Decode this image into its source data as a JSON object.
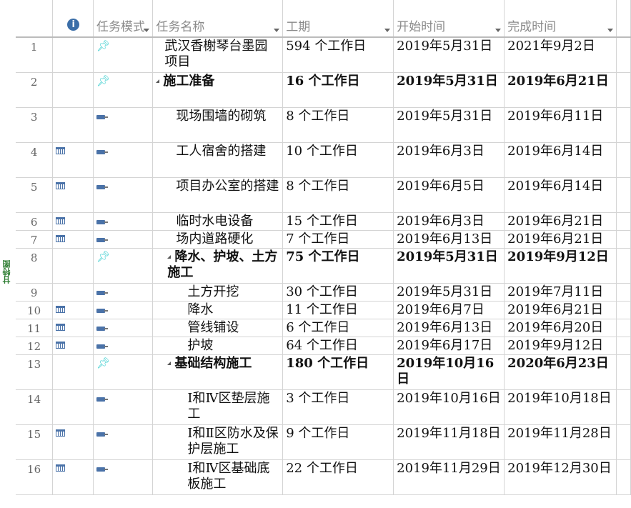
{
  "side_label": "甘特图",
  "columns": {
    "mode": "任务模式",
    "name": "任务名称",
    "duration": "工期",
    "start": "开始时间",
    "finish": "完成时间"
  },
  "rows": [
    {
      "id": "1",
      "info": false,
      "mode": "manual",
      "level": 0,
      "bold": false,
      "name": "武汉香榭琴台墨园项目",
      "duration": "594 个工作日",
      "start": "2019年5月31日",
      "finish": "2021年9月2日"
    },
    {
      "id": "2",
      "info": false,
      "mode": "manual",
      "level": 0,
      "bold": true,
      "summary": true,
      "name": "施工准备",
      "duration": "16 个工作日",
      "start": "2019年5月31日",
      "finish": "2019年6月21日"
    },
    {
      "id": "3",
      "info": false,
      "mode": "auto",
      "level": 1,
      "bold": false,
      "name": "现场围墙的砌筑",
      "duration": "8 个工作日",
      "start": "2019年5月31日",
      "finish": "2019年6月11日"
    },
    {
      "id": "4",
      "info": true,
      "mode": "auto",
      "level": 1,
      "bold": false,
      "name": "工人宿舍的搭建",
      "duration": "10 个工作日",
      "start": "2019年6月3日",
      "finish": "2019年6月14日"
    },
    {
      "id": "5",
      "info": true,
      "mode": "auto",
      "level": 1,
      "bold": false,
      "name": "项目办公室的搭建",
      "duration": "8 个工作日",
      "start": "2019年6月5日",
      "finish": "2019年6月14日"
    },
    {
      "id": "6",
      "info": true,
      "mode": "auto",
      "level": 1,
      "bold": false,
      "name": "临时水电设备",
      "duration": "15 个工作日",
      "start": "2019年6月3日",
      "finish": "2019年6月21日"
    },
    {
      "id": "7",
      "info": true,
      "mode": "auto",
      "level": 1,
      "bold": false,
      "name": "场内道路硬化",
      "duration": "7 个工作日",
      "start": "2019年6月13日",
      "finish": "2019年6月21日"
    },
    {
      "id": "8",
      "info": false,
      "mode": "manual",
      "level": 1,
      "bold": true,
      "summary": true,
      "name": "降水、护坡、土方施工",
      "duration": "75 个工作日",
      "start": "2019年5月31日",
      "finish": "2019年9月12日"
    },
    {
      "id": "9",
      "info": false,
      "mode": "auto",
      "level": 2,
      "bold": false,
      "name": "土方开挖",
      "duration": "30 个工作日",
      "start": "2019年5月31日",
      "finish": "2019年7月11日"
    },
    {
      "id": "10",
      "info": true,
      "mode": "auto",
      "level": 2,
      "bold": false,
      "name": "降水",
      "duration": "11 个工作日",
      "start": "2019年6月7日",
      "finish": "2019年6月21日"
    },
    {
      "id": "11",
      "info": true,
      "mode": "auto",
      "level": 2,
      "bold": false,
      "name": "管线铺设",
      "duration": "6 个工作日",
      "start": "2019年6月13日",
      "finish": "2019年6月20日"
    },
    {
      "id": "12",
      "info": true,
      "mode": "auto",
      "level": 2,
      "bold": false,
      "name": "护坡",
      "duration": "64 个工作日",
      "start": "2019年6月17日",
      "finish": "2019年9月12日"
    },
    {
      "id": "13",
      "info": false,
      "mode": "manual",
      "level": 1,
      "bold": true,
      "summary": true,
      "name": "基础结构施工",
      "duration": "180 个工作日",
      "start": "2019年10月16日",
      "finish": "2020年6月23日"
    },
    {
      "id": "14",
      "info": false,
      "mode": "auto",
      "level": 2,
      "bold": false,
      "name": "Ⅰ和Ⅳ区垫层施工",
      "duration": "3 个工作日",
      "start": "2019年10月16日",
      "finish": "2019年10月18日"
    },
    {
      "id": "15",
      "info": true,
      "mode": "auto",
      "level": 2,
      "bold": false,
      "name": "Ⅰ和Ⅱ区防水及保护层施工",
      "duration": "9 个工作日",
      "start": "2019年11月18日",
      "finish": "2019年11月28日"
    },
    {
      "id": "16",
      "info": true,
      "mode": "auto",
      "level": 2,
      "bold": false,
      "name": "Ⅰ和Ⅳ区基础底板施工",
      "duration": "22 个工作日",
      "start": "2019年11月29日",
      "finish": "2019年12月30日"
    }
  ]
}
